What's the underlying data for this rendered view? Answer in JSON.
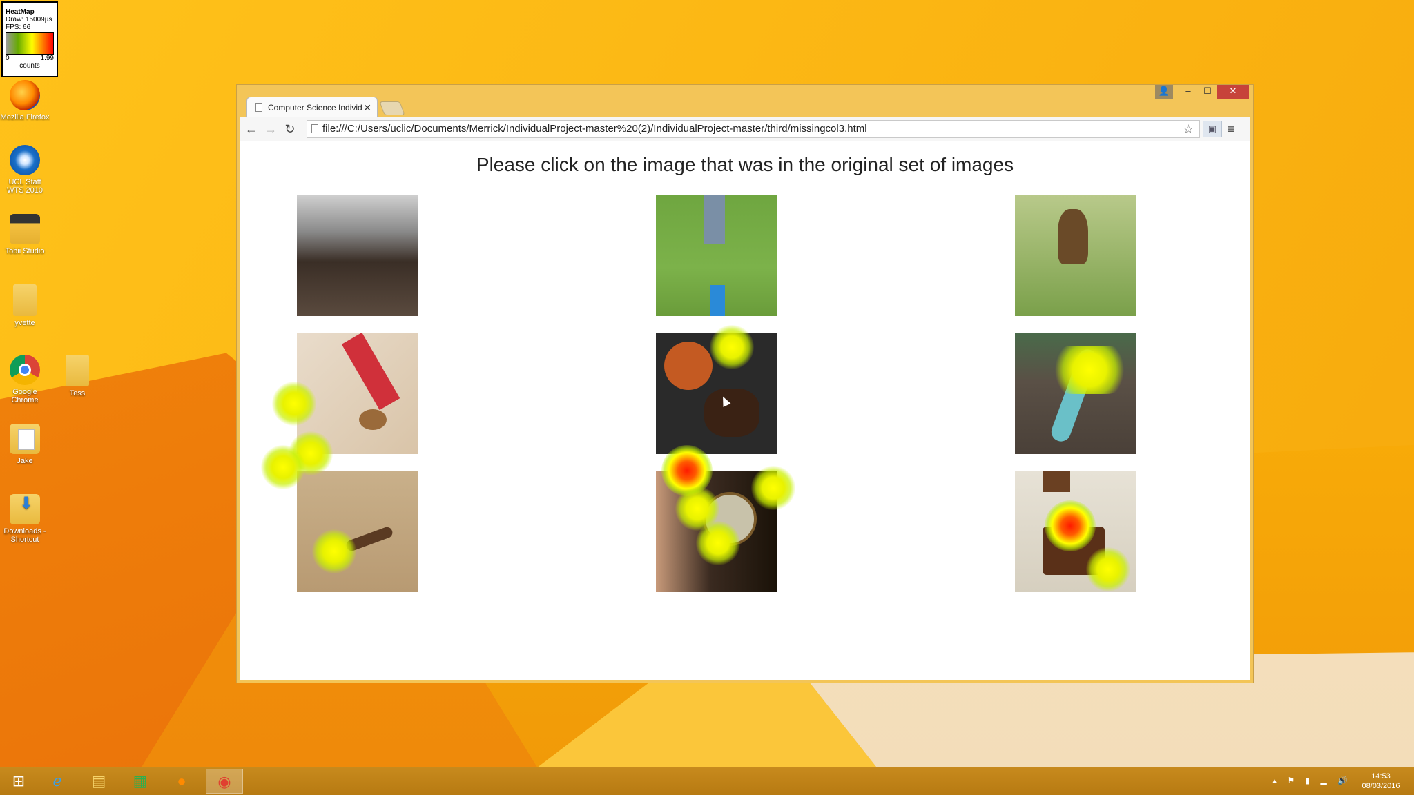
{
  "legend": {
    "title": "HeatMap",
    "draw": "Draw: 15009µs",
    "fps": "FPS: 66",
    "min": "0",
    "max": "1.99",
    "unit": "counts"
  },
  "desktop_icons": [
    {
      "label": "Mozilla Firefox",
      "icon": "firefox-icon"
    },
    {
      "label": "UCL Staff WTS 2010",
      "icon": "ucl-wts-icon"
    },
    {
      "label": "Tobii Studio",
      "icon": "tobii-studio-icon"
    },
    {
      "label": "yvette",
      "icon": "folder-icon"
    },
    {
      "label": "Google Chrome",
      "icon": "chrome-icon"
    },
    {
      "label": "Tess",
      "icon": "folder-icon"
    },
    {
      "label": "Jake",
      "icon": "document-folder-icon"
    },
    {
      "label": "Downloads - Shortcut",
      "icon": "downloads-shortcut-icon"
    }
  ],
  "browser": {
    "tab_title": "Computer Science Individ",
    "url": "file:///C:/Users/uclic/Documents/Merrick/IndividualProject-master%20(2)/IndividualProject-master/third/missingcol3.html"
  },
  "page": {
    "heading": "Please click on the image that was in the original set of images",
    "images": [
      {
        "subject": "beard"
      },
      {
        "subject": "child on grass"
      },
      {
        "subject": "dog in field"
      },
      {
        "subject": "tools and walnuts"
      },
      {
        "subject": "coffee beans"
      },
      {
        "subject": "skateboard on fence"
      },
      {
        "subject": "stamp on wood"
      },
      {
        "subject": "vintage radio"
      },
      {
        "subject": "wallet in pocket"
      }
    ]
  },
  "taskbar": {
    "time": "14:53",
    "date": "08/03/2016"
  },
  "colors": {
    "desktop": "#f8ab08",
    "window_frame": "#f3c558",
    "close_button": "#c7433a",
    "heat_low": "#ffff00",
    "heat_high": "#ff1a00"
  }
}
